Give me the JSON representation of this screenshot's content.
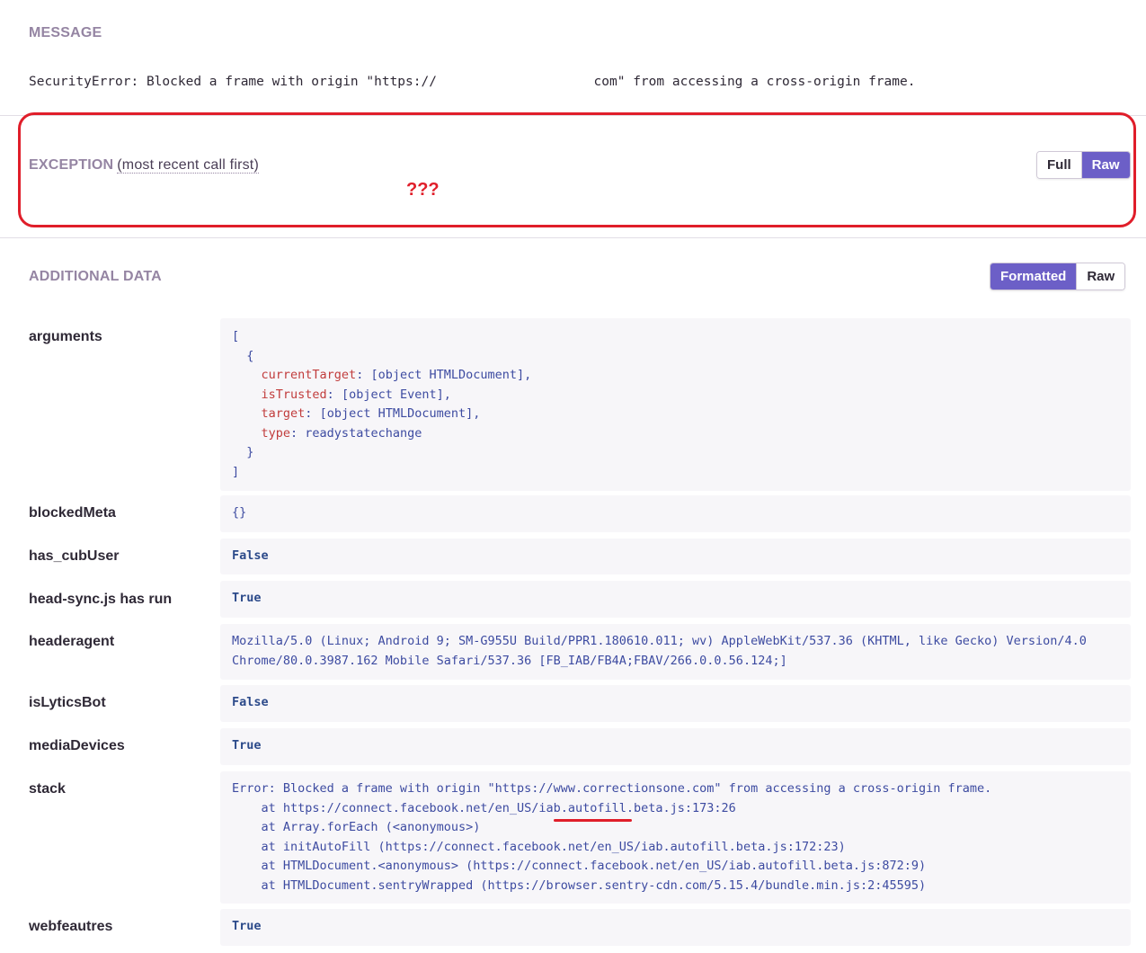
{
  "message": {
    "heading": "MESSAGE",
    "text": "SecurityError: Blocked a frame with origin \"https://                    com\" from accessing a cross-origin frame."
  },
  "exception": {
    "heading": "EXCEPTION",
    "subheading": "(most recent call first)",
    "buttons": {
      "full": "Full",
      "raw": "Raw"
    },
    "annotation": "???"
  },
  "additional": {
    "heading": "ADDITIONAL DATA",
    "buttons": {
      "formatted": "Formatted",
      "raw": "Raw"
    },
    "rows": {
      "arguments": {
        "key": "arguments",
        "lines": {
          "open": "[",
          "obj_open": "{",
          "k1": "currentTarget",
          "v1": "[object HTMLDocument],",
          "k2": "isTrusted",
          "v2": "[object Event],",
          "k3": "target",
          "v3": "[object HTMLDocument],",
          "k4": "type",
          "v4": "readystatechange",
          "obj_close": "}",
          "close": "]"
        }
      },
      "blockedMeta": {
        "key": "blockedMeta",
        "value": "{}"
      },
      "has_cubUser": {
        "key": "has_cubUser",
        "value": "False"
      },
      "head_sync": {
        "key": "head-sync.js has run",
        "value": "True"
      },
      "headeragent": {
        "key": "headeragent",
        "line1": "Mozilla/5.0 (Linux; Android 9; SM-G955U Build/PPR1.180610.011; wv) AppleWebKit/537.36 (KHTML, like Gecko) Version/4.0",
        "line2": "Chrome/80.0.3987.162 Mobile Safari/537.36 [FB_IAB/FB4A;FBAV/266.0.0.56.124;]"
      },
      "isLyticsBot": {
        "key": "isLyticsBot",
        "value": "False"
      },
      "mediaDevices": {
        "key": "mediaDevices",
        "value": "True"
      },
      "stack": {
        "key": "stack",
        "line1": "Error: Blocked a frame with origin \"https://www.correctionsone.com\" from accessing a cross-origin frame.",
        "line2": "    at https://connect.facebook.net/en_US/iab.autofill.beta.js:173:26",
        "line3": "    at Array.forEach (<anonymous>)",
        "line4": "    at initAutoFill (https://connect.facebook.net/en_US/iab.autofill.beta.js:172:23)",
        "line5": "    at HTMLDocument.<anonymous> (https://connect.facebook.net/en_US/iab.autofill.beta.js:872:9)",
        "line6": "    at HTMLDocument.sentryWrapped (https://browser.sentry-cdn.com/5.15.4/bundle.min.js:2:45595)"
      },
      "webfeautres": {
        "key": "webfeautres",
        "value": "True"
      }
    }
  },
  "colors": {
    "accent": "#6c5fc7",
    "heading": "#9585a3",
    "annotation": "#e01e2a"
  }
}
